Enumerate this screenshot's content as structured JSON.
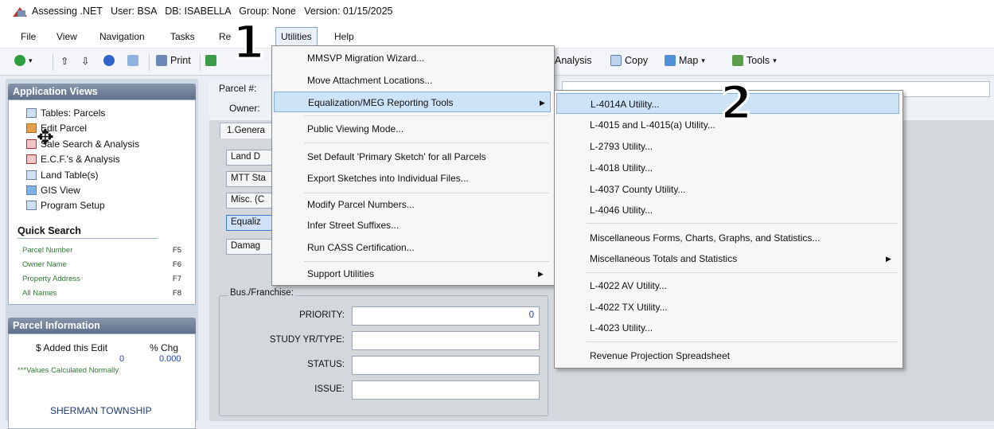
{
  "title_bar": {
    "text": "Assessing .NET   User: BSA   DB: ISABELLA   Group: None   Version: 01/15/2025"
  },
  "menu": {
    "file": "File",
    "view": "View",
    "navigation": "Navigation",
    "tasks": "Tasks",
    "reports": "Re",
    "utilities": "Utilities",
    "help": "Help"
  },
  "toolbar": {
    "print": "Print",
    "analysis": "Analysis",
    "copy": "Copy",
    "map": "Map",
    "tools": "Tools"
  },
  "application_views": {
    "title": "Application Views",
    "items": [
      "Tables: Parcels",
      "Edit Parcel",
      "Sale Search & Analysis",
      "E.C.F.'s & Analysis",
      "Land Table(s)",
      "GIS View",
      "Program Setup"
    ]
  },
  "quick_search": {
    "title": "Quick Search",
    "rows": [
      {
        "label": "Parcel Number",
        "key": "F5"
      },
      {
        "label": "Owner Name",
        "key": "F6"
      },
      {
        "label": "Property Address",
        "key": "F7"
      },
      {
        "label": "All Names",
        "key": "F8"
      }
    ]
  },
  "parcel_information": {
    "title": "Parcel Information",
    "added_label": "$ Added this Edit",
    "chg_label": "% Chg",
    "added_value": "0",
    "chg_value": "0.000",
    "note": "***Values Calculated Normally",
    "township": "SHERMAN TOWNSHIP"
  },
  "main": {
    "parcel_label": "Parcel #:",
    "owner_label": "Owner:",
    "tab_general": "1.Genera",
    "side_buttons": [
      "Land D",
      "MTT Sta",
      "Misc. (C",
      "Equaliz",
      "Damag"
    ],
    "bus_franchise_title": "Bus./Franchise:",
    "fields": [
      {
        "label": "PRIORITY:",
        "value": "0"
      },
      {
        "label": "STUDY YR/TYPE:",
        "value": ""
      },
      {
        "label": "STATUS:",
        "value": ""
      },
      {
        "label": "ISSUE:",
        "value": ""
      }
    ]
  },
  "utilities_menu": {
    "items": [
      "MMSVP Migration Wizard...",
      "Move Attachment Locations...",
      "Equalization/MEG Reporting Tools",
      "Public Viewing Mode...",
      "Set Default 'Primary Sketch' for all Parcels",
      "Export Sketches into Individual Files...",
      "Modify Parcel Numbers...",
      "Infer Street Suffixes...",
      "Run CASS Certification...",
      "Support Utilities"
    ]
  },
  "meg_submenu": {
    "items": [
      "L-4014A Utility...",
      "L-4015 and L-4015(a) Utility...",
      "L-2793 Utility...",
      "L-4018 Utility...",
      "L-4037 County Utility...",
      "L-4046 Utility...",
      "Miscellaneous Forms, Charts, Graphs, and Statistics...",
      "Miscellaneous Totals and Statistics",
      "L-4022 AV Utility...",
      "L-4022 TX Utility...",
      "L-4023 Utility...",
      "Revenue Projection Spreadsheet"
    ]
  },
  "annotations": {
    "step1": "1",
    "step2": "2"
  },
  "colors": {
    "highlight": "#cde3f8",
    "panel_header": "#5f7089",
    "quick_search_green": "#2e7d32"
  }
}
